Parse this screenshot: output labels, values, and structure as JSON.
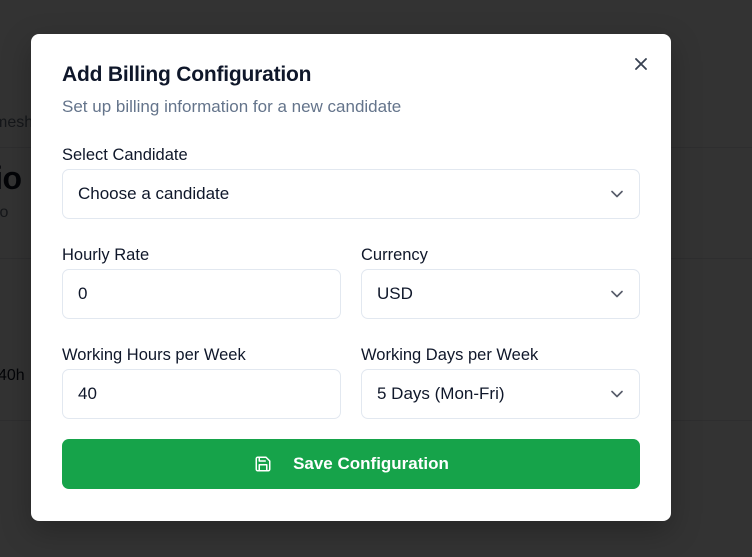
{
  "background": {
    "breadcrumb_fragment": "mesh",
    "heading_fragment": "tio",
    "subtitle_fragment": "wo",
    "cell_fragment": "40h"
  },
  "dialog": {
    "title": "Add Billing Configuration",
    "description": "Set up billing information for a new candidate",
    "close_icon": "close-icon",
    "fields": {
      "candidate": {
        "label": "Select Candidate",
        "placeholder": "Choose a candidate"
      },
      "hourly_rate": {
        "label": "Hourly Rate",
        "value": "0"
      },
      "currency": {
        "label": "Currency",
        "value": "USD"
      },
      "hours_per_week": {
        "label": "Working Hours per Week",
        "value": "40"
      },
      "days_per_week": {
        "label": "Working Days per Week",
        "value": "5 Days (Mon-Fri)"
      }
    },
    "save_button": {
      "label": "Save Configuration",
      "icon": "save-icon"
    }
  },
  "colors": {
    "primary": "#16a34a",
    "overlay": "#000000",
    "muted_text": "#64748b",
    "border": "#e2e8f0"
  }
}
